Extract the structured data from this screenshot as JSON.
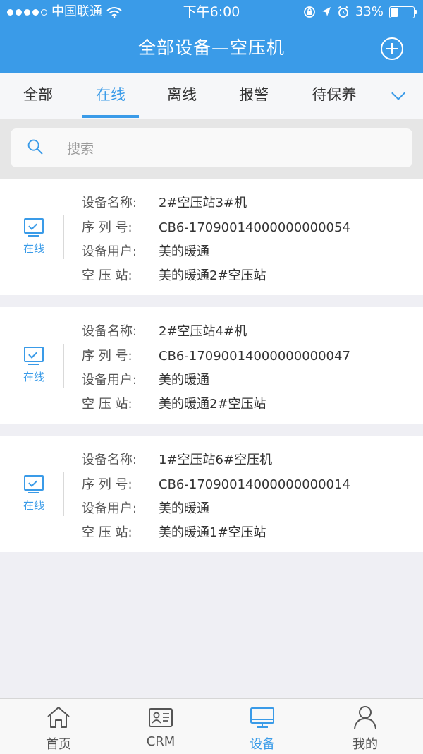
{
  "status_bar": {
    "carrier": "中国联通",
    "time": "下午6:00",
    "battery": "33%",
    "battery_level": 0.33
  },
  "header": {
    "title": "全部设备—空压机",
    "add_icon": "plus-circle-icon"
  },
  "tabs": [
    {
      "label": "全部",
      "active": false
    },
    {
      "label": "在线",
      "active": true
    },
    {
      "label": "离线",
      "active": false
    },
    {
      "label": "报警",
      "active": false
    },
    {
      "label": "待保养",
      "active": false
    }
  ],
  "search": {
    "placeholder": "搜索"
  },
  "field_labels": {
    "name": "设备名称:",
    "serial": "序 列 号:",
    "user": "设备用户:",
    "station": "空 压 站:"
  },
  "devices": [
    {
      "status": "在线",
      "name": "2#空压站3#机",
      "serial": "CB6-17090014000000000054",
      "user": "美的暖通",
      "station": "美的暖通2#空压站"
    },
    {
      "status": "在线",
      "name": "2#空压站4#机",
      "serial": "CB6-17090014000000000047",
      "user": "美的暖通",
      "station": "美的暖通2#空压站"
    },
    {
      "status": "在线",
      "name": "1#空压站6#空压机",
      "serial": "CB6-17090014000000000014",
      "user": "美的暖通",
      "station": "美的暖通1#空压站"
    }
  ],
  "bottom_nav": [
    {
      "label": "首页",
      "icon": "home-icon",
      "active": false
    },
    {
      "label": "CRM",
      "icon": "id-card-icon",
      "active": false
    },
    {
      "label": "设备",
      "icon": "monitor-icon",
      "active": true
    },
    {
      "label": "我的",
      "icon": "person-icon",
      "active": false
    }
  ],
  "colors": {
    "accent": "#3a9be8",
    "background": "#efeff4"
  }
}
